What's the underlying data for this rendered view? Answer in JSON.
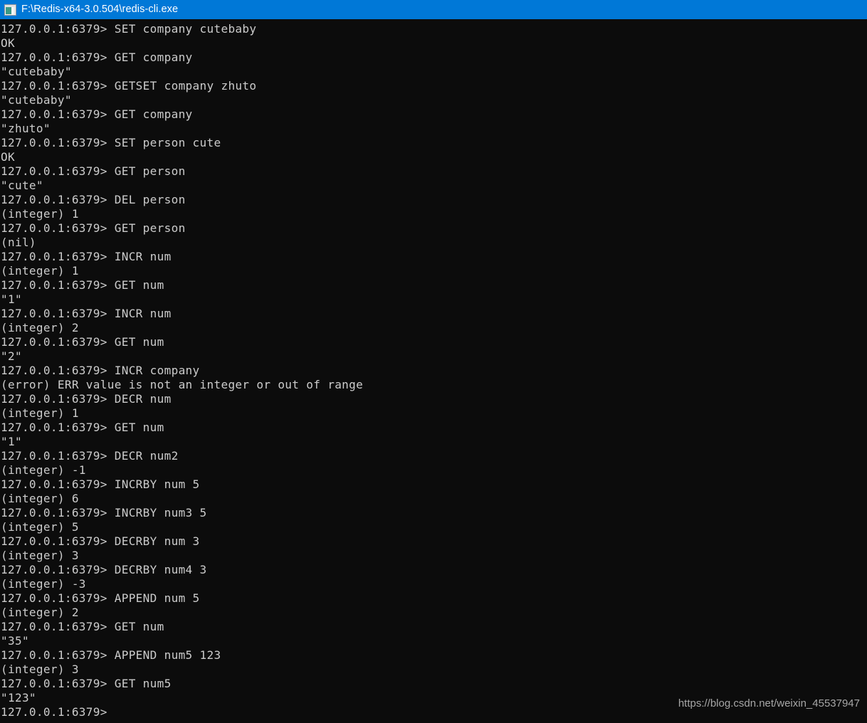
{
  "window": {
    "title": "F:\\Redis-x64-3.0.504\\redis-cli.exe",
    "icon": "console-window-icon",
    "titlebar_color": "#0078d7",
    "background_color": "#0c0c0c",
    "text_color": "#cccccc"
  },
  "terminal": {
    "prompt": "127.0.0.1:6379>",
    "lines": [
      "127.0.0.1:6379> SET company cutebaby",
      "OK",
      "127.0.0.1:6379> GET company",
      "\"cutebaby\"",
      "127.0.0.1:6379> GETSET company zhuto",
      "\"cutebaby\"",
      "127.0.0.1:6379> GET company",
      "\"zhuto\"",
      "127.0.0.1:6379> SET person cute",
      "OK",
      "127.0.0.1:6379> GET person",
      "\"cute\"",
      "127.0.0.1:6379> DEL person",
      "(integer) 1",
      "127.0.0.1:6379> GET person",
      "(nil)",
      "127.0.0.1:6379> INCR num",
      "(integer) 1",
      "127.0.0.1:6379> GET num",
      "\"1\"",
      "127.0.0.1:6379> INCR num",
      "(integer) 2",
      "127.0.0.1:6379> GET num",
      "\"2\"",
      "127.0.0.1:6379> INCR company",
      "(error) ERR value is not an integer or out of range",
      "127.0.0.1:6379> DECR num",
      "(integer) 1",
      "127.0.0.1:6379> GET num",
      "\"1\"",
      "127.0.0.1:6379> DECR num2",
      "(integer) -1",
      "127.0.0.1:6379> INCRBY num 5",
      "(integer) 6",
      "127.0.0.1:6379> INCRBY num3 5",
      "(integer) 5",
      "127.0.0.1:6379> DECRBY num 3",
      "(integer) 3",
      "127.0.0.1:6379> DECRBY num4 3",
      "(integer) -3",
      "127.0.0.1:6379> APPEND num 5",
      "(integer) 2",
      "127.0.0.1:6379> GET num",
      "\"35\"",
      "127.0.0.1:6379> APPEND num5 123",
      "(integer) 3",
      "127.0.0.1:6379> GET num5",
      "\"123\"",
      "127.0.0.1:6379>"
    ]
  },
  "watermark": {
    "text": "https://blog.csdn.net/weixin_45537947"
  }
}
